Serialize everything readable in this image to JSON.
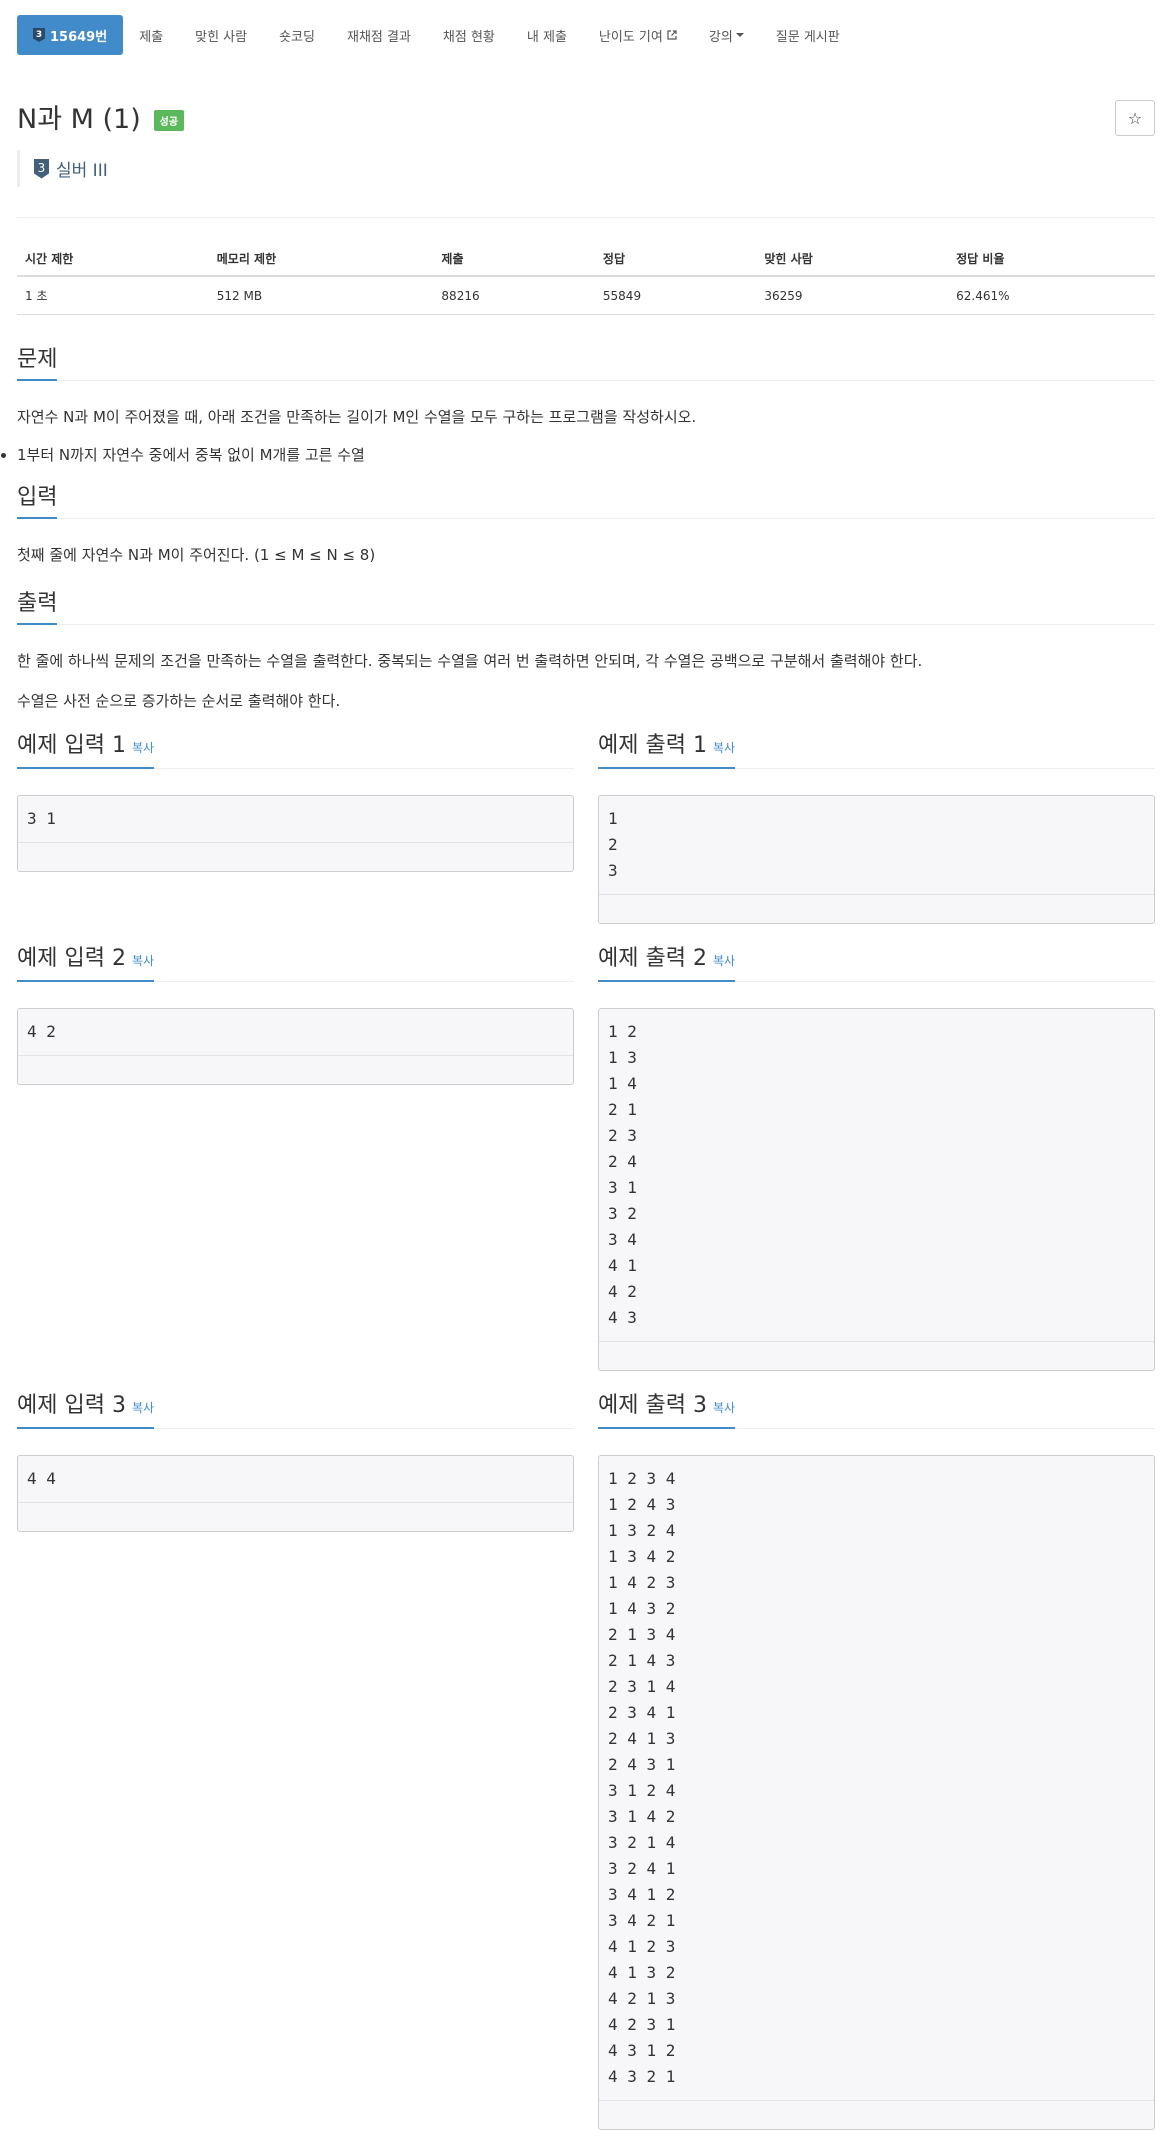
{
  "nav": {
    "items": [
      {
        "label": "15649번",
        "active": true,
        "tier": "3"
      },
      {
        "label": "제출"
      },
      {
        "label": "맞힌 사람"
      },
      {
        "label": "숏코딩"
      },
      {
        "label": "재채점 결과"
      },
      {
        "label": "채점 현황"
      },
      {
        "label": "내 제출"
      },
      {
        "label": "난이도 기여",
        "external": true
      },
      {
        "label": "강의",
        "dropdown": true
      },
      {
        "label": "질문 게시판"
      }
    ]
  },
  "problem": {
    "title": "N과 M (1)",
    "status_badge": "성공",
    "tier_badge": "3",
    "tier": "실버 III",
    "star": "☆"
  },
  "stats": {
    "headers": [
      "시간 제한",
      "메모리 제한",
      "제출",
      "정답",
      "맞힌 사람",
      "정답 비율"
    ],
    "values": [
      "1 초",
      "512 MB",
      "88216",
      "55849",
      "36259",
      "62.461%"
    ]
  },
  "sections": {
    "problem_title": "문제",
    "problem_text": "자연수 N과 M이 주어졌을 때, 아래 조건을 만족하는 길이가 M인 수열을 모두 구하는 프로그램을 작성하시오.",
    "problem_list": [
      "1부터 N까지 자연수 중에서 중복 없이 M개를 고른 수열"
    ],
    "input_title": "입력",
    "input_text": "첫째 줄에 자연수 N과 M이 주어진다. (1 ≤ M ≤ N ≤ 8)",
    "output_title": "출력",
    "output_text_1": "한 줄에 하나씩 문제의 조건을 만족하는 수열을 출력한다. 중복되는 수열을 여러 번 출력하면 안되며, 각 수열은 공백으로 구분해서 출력해야 한다.",
    "output_text_2": "수열은 사전 순으로 증가하는 순서로 출력해야 한다."
  },
  "copy_label": "복사",
  "samples": [
    {
      "input_title": "예제 입력 1",
      "output_title": "예제 출력 1",
      "input": "3 1",
      "output": "1\n2\n3"
    },
    {
      "input_title": "예제 입력 2",
      "output_title": "예제 출력 2",
      "input": "4 2",
      "output": "1 2\n1 3\n1 4\n2 1\n2 3\n2 4\n3 1\n3 2\n3 4\n4 1\n4 2\n4 3"
    },
    {
      "input_title": "예제 입력 3",
      "output_title": "예제 출력 3",
      "input": "4 4",
      "output": "1 2 3 4\n1 2 4 3\n1 3 2 4\n1 3 4 2\n1 4 2 3\n1 4 3 2\n2 1 3 4\n2 1 4 3\n2 3 1 4\n2 3 4 1\n2 4 1 3\n2 4 3 1\n3 1 2 4\n3 1 4 2\n3 2 1 4\n3 2 4 1\n3 4 1 2\n3 4 2 1\n4 1 2 3\n4 1 3 2\n4 2 1 3\n4 2 3 1\n4 3 1 2\n4 3 2 1"
    }
  ]
}
